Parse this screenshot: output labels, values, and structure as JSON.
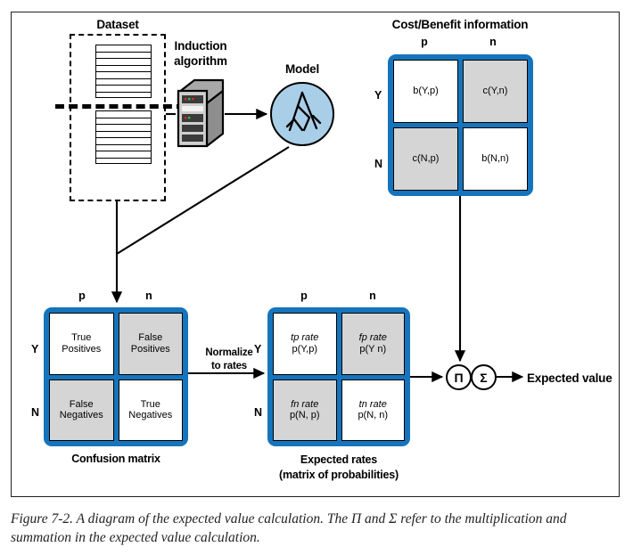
{
  "figure": {
    "caption": "Figure 7-2. A diagram of the expected value calculation. The Π and Σ refer to the multiplication and summation in the expected value calculation."
  },
  "dataset": {
    "label": "Dataset"
  },
  "induction": {
    "label_line1": "Induction",
    "label_line2": "algorithm",
    "icon": "server-icon"
  },
  "model": {
    "label": "Model",
    "icon": "decision-tree-icon",
    "fill": "#a9cfe8"
  },
  "cost_benefit": {
    "title": "Cost/Benefit information",
    "col_headers": [
      "p",
      "n"
    ],
    "row_headers": [
      "Y",
      "N"
    ],
    "cells": [
      {
        "text": "b(Y,p)",
        "shade": "white"
      },
      {
        "text": "c(Y,n)",
        "shade": "grey"
      },
      {
        "text": "c(N,p)",
        "shade": "grey"
      },
      {
        "text": "b(N,n)",
        "shade": "white"
      }
    ]
  },
  "confusion_matrix": {
    "caption": "Confusion matrix",
    "col_headers": [
      "p",
      "n"
    ],
    "row_headers": [
      "Y",
      "N"
    ],
    "cells": [
      {
        "line1": "True",
        "line2": "Positives",
        "shade": "white"
      },
      {
        "line1": "False",
        "line2": "Positives",
        "shade": "grey"
      },
      {
        "line1": "False",
        "line2": "Negatives",
        "shade": "grey"
      },
      {
        "line1": "True",
        "line2": "Negatives",
        "shade": "white"
      }
    ]
  },
  "normalize_arrow": {
    "line1": "Normalize",
    "line2": "to rates"
  },
  "expected_rates": {
    "caption_line1": "Expected rates",
    "caption_line2": "(matrix of probabilities)",
    "col_headers": [
      "p",
      "n"
    ],
    "row_headers": [
      "Y",
      "N"
    ],
    "cells": [
      {
        "line1": "tp rate",
        "line2": "p(Y,p)",
        "shade": "white"
      },
      {
        "line1": "fp rate",
        "line2": "p(Y n)",
        "shade": "grey"
      },
      {
        "line1": "fn rate",
        "line2": "p(N, p)",
        "shade": "grey"
      },
      {
        "line1": "tn rate",
        "line2": "p(N, n)",
        "shade": "white"
      }
    ]
  },
  "operators": {
    "product": "Π",
    "sum": "Σ"
  },
  "output": {
    "label": "Expected value"
  },
  "colors": {
    "matrix_blue": "#1574bc",
    "cell_grey": "#d5d5d5",
    "model_blue": "#a9cfe8"
  }
}
